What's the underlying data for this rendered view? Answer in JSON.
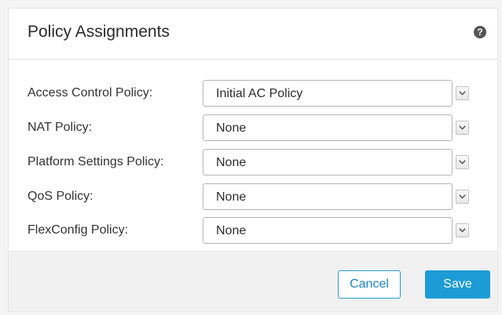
{
  "dialog": {
    "title": "Policy Assignments",
    "help_icon": "question-circle-icon",
    "help_glyph": "?"
  },
  "fields": [
    {
      "label": "Access Control Policy:",
      "value": "Initial AC Policy"
    },
    {
      "label": "NAT Policy:",
      "value": "None"
    },
    {
      "label": "Platform Settings Policy:",
      "value": "None"
    },
    {
      "label": "QoS Policy:",
      "value": "None"
    },
    {
      "label": "FlexConfig Policy:",
      "value": "None"
    }
  ],
  "footer": {
    "cancel_label": "Cancel",
    "save_label": "Save"
  },
  "colors": {
    "accent": "#1d9bd7",
    "cancel_text": "#1d86c4"
  }
}
